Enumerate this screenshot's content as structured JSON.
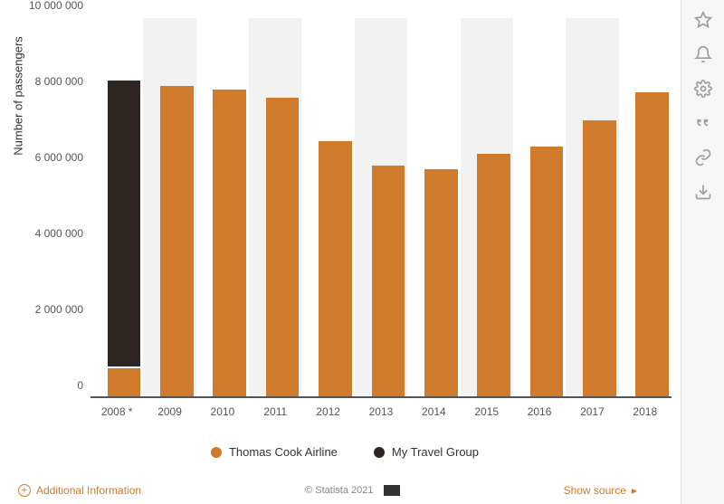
{
  "chart_data": {
    "type": "bar",
    "stacked": true,
    "categories": [
      "2008 *",
      "2009",
      "2010",
      "2011",
      "2012",
      "2013",
      "2014",
      "2015",
      "2016",
      "2017",
      "2018"
    ],
    "series": [
      {
        "name": "Thomas Cook Airline",
        "color": "#d07a2b",
        "values": [
          750000,
          8200000,
          8100000,
          7900000,
          6750000,
          6100000,
          6000000,
          6400000,
          6600000,
          7300000,
          8050000
        ]
      },
      {
        "name": "My Travel Group",
        "color": "#2e2622",
        "values": [
          7550000,
          0,
          0,
          0,
          0,
          0,
          0,
          0,
          0,
          0,
          0
        ]
      }
    ],
    "ylabel": "Number of passengers",
    "xlabel": "",
    "ylim": [
      0,
      10000000
    ],
    "yticks": [
      0,
      2000000,
      4000000,
      6000000,
      8000000,
      10000000
    ],
    "ytick_labels": [
      "0",
      "2 000 000",
      "4 000 000",
      "6 000 000",
      "8 000 000",
      "10 000 000"
    ]
  },
  "legend": {
    "items": [
      {
        "label": "Thomas Cook Airline"
      },
      {
        "label": "My Travel Group"
      }
    ]
  },
  "footer": {
    "additional": "Additional Information",
    "copyright": "© Statista 2021",
    "show_source": "Show source"
  },
  "sidebar_icons": [
    "star-icon",
    "bell-icon",
    "gear-icon",
    "quote-icon",
    "link-icon",
    "download-icon"
  ]
}
